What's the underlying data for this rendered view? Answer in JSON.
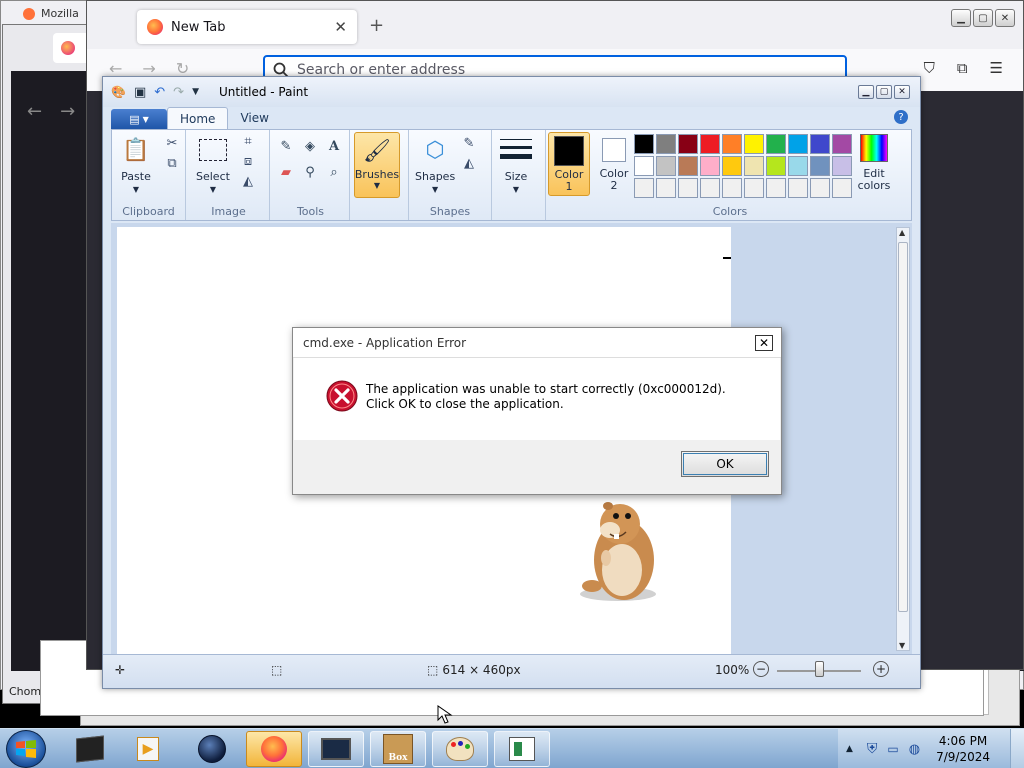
{
  "background": {
    "win1_tab": "Mozilla",
    "win2_label": "Chom"
  },
  "firefox": {
    "tab_title": "New Tab",
    "tab_close": "✕",
    "new_tab": "+",
    "url_placeholder": "Search or enter address"
  },
  "paint": {
    "title": "Untitled - Paint",
    "tabs": [
      "Home",
      "View"
    ],
    "groups": {
      "clipboard": "Clipboard",
      "image": "Image",
      "tools": "Tools",
      "shapes": "Shapes",
      "colors": "Colors"
    },
    "buttons": {
      "paste": "Paste",
      "select": "Select",
      "brushes": "Brushes",
      "shapes": "Shapes",
      "size": "Size",
      "color1": "Color 1",
      "color1_line1": "Color",
      "color1_line2": "1",
      "color2_line1": "Color",
      "color2_line2": "2",
      "edit_colors_line1": "Edit",
      "edit_colors_line2": "colors"
    },
    "palette": [
      "#000000",
      "#7f7f7f",
      "#880015",
      "#ed1c24",
      "#ff7f27",
      "#fff200",
      "#22b14c",
      "#00a2e8",
      "#3f48cc",
      "#a349a4",
      "#ffffff",
      "#c3c3c3",
      "#b97a57",
      "#ffaec9",
      "#ffc90e",
      "#efe4b0",
      "#b5e61d",
      "#99d9ea",
      "#7092be",
      "#c8bfe7",
      "#f0f0f0",
      "#f0f0f0",
      "#f0f0f0",
      "#f0f0f0",
      "#f0f0f0",
      "#f0f0f0",
      "#f0f0f0",
      "#f0f0f0",
      "#f0f0f0",
      "#f0f0f0"
    ],
    "status": {
      "dimensions": "614 × 460px",
      "zoom": "100%"
    }
  },
  "dialog": {
    "title": "cmd.exe - Application Error",
    "message": "The application was unable to start correctly (0xc000012d). Click OK to close the application.",
    "ok": "OK",
    "close": "✕"
  },
  "taskbar": {
    "time": "4:06 PM",
    "date": "7/9/2024",
    "box_label": "Box"
  }
}
